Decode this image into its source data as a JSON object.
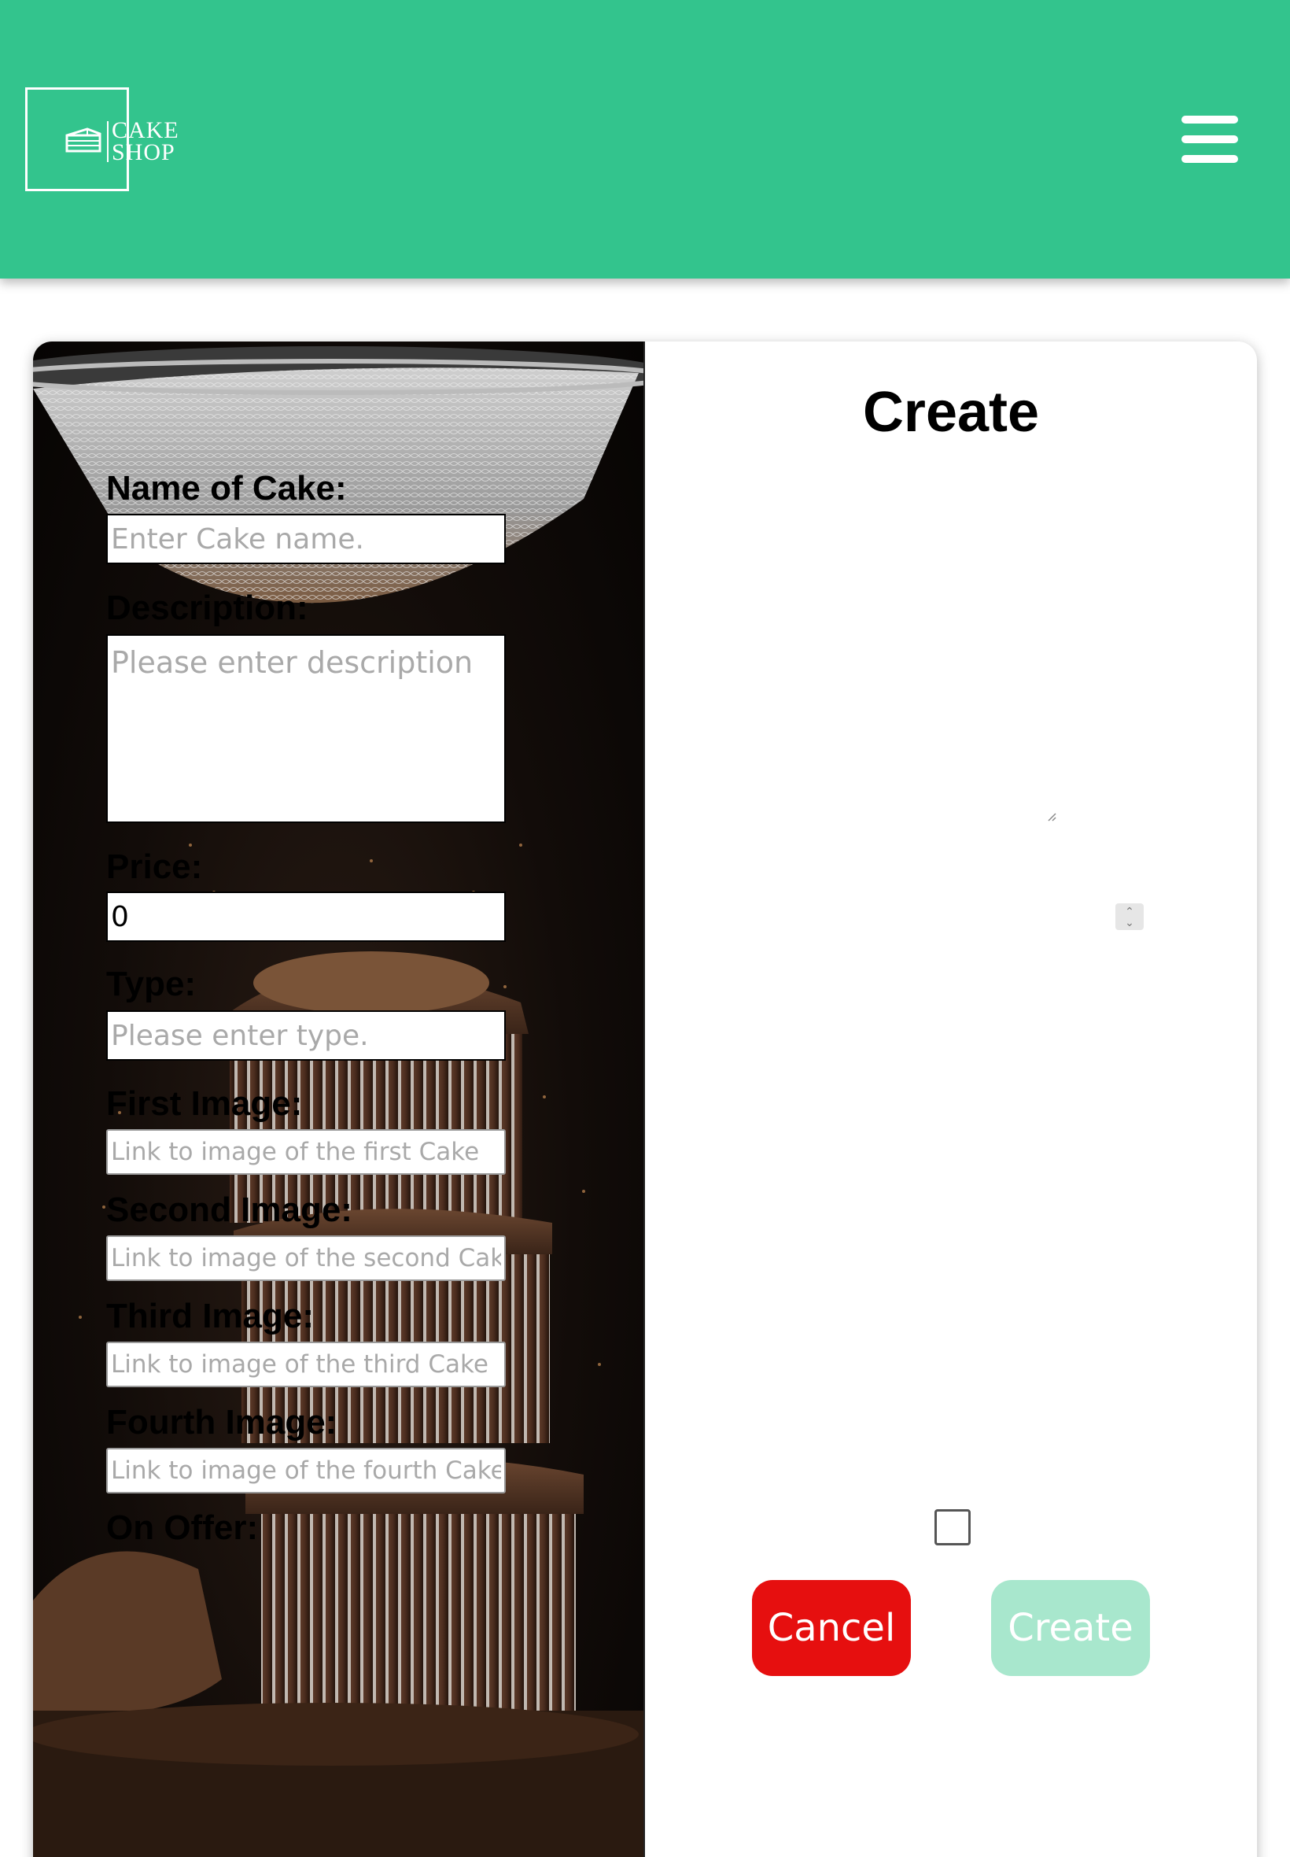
{
  "header": {
    "logo_line1": "CAKE",
    "logo_line2": "SHOP",
    "bg_color": "#33c48d"
  },
  "form": {
    "title": "Create",
    "name_label": "Name of Cake:",
    "name_placeholder": "Enter Cake name.",
    "description_label": "Description:",
    "description_placeholder": "Please enter description",
    "price_label": "Price:",
    "price_value": "0",
    "type_label": "Type:",
    "type_placeholder": "Please enter type.",
    "first_image_label": "First Image:",
    "first_image_placeholder": "Link to image of the first Cake",
    "second_image_label": "Second Image:",
    "second_image_placeholder": "Link to image of the second Cake",
    "third_image_label": "Third Image:",
    "third_image_placeholder": "Link to image of the third Cake",
    "fourth_image_label": "Fourth Image:",
    "fourth_image_placeholder": "Link to image of the fourth Cake",
    "on_offer_label": "On Offer:",
    "on_offer_checked": false
  },
  "buttons": {
    "cancel_label": "Cancel",
    "create_label": "Create",
    "cancel_color": "#e60f0f",
    "create_color": "#a8e7cd"
  },
  "icons": {
    "menu": "hamburger-menu-icon",
    "logo": "cake-slice-icon"
  }
}
